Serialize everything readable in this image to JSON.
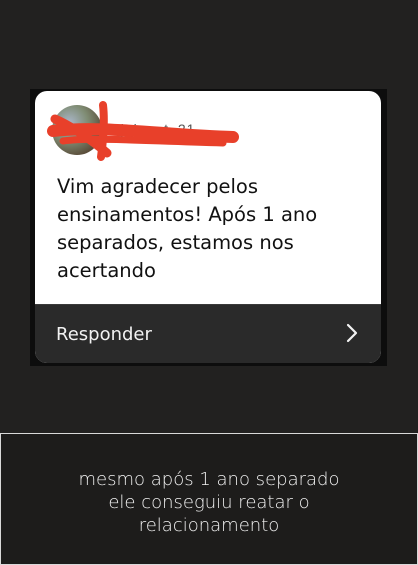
{
  "story_reply": {
    "username": "_j_i_n_t_21",
    "message_lines": [
      "Vim agradecer pelos",
      "ensinamentos! Após 1 ano",
      "separados, estamos nos",
      "acertando"
    ],
    "reply_label": "Responder",
    "reply_icon": "chevron-right-icon"
  },
  "caption": {
    "lines": [
      "mesmo após 1 ano separado",
      "ele conseguiu reatar o",
      "relacionamento"
    ]
  },
  "colors": {
    "background": "#222120",
    "card": "#ffffff",
    "reply_bar": "#2a2a2a",
    "redaction": "#e8402a",
    "caption_border": "#d9d9d9"
  }
}
